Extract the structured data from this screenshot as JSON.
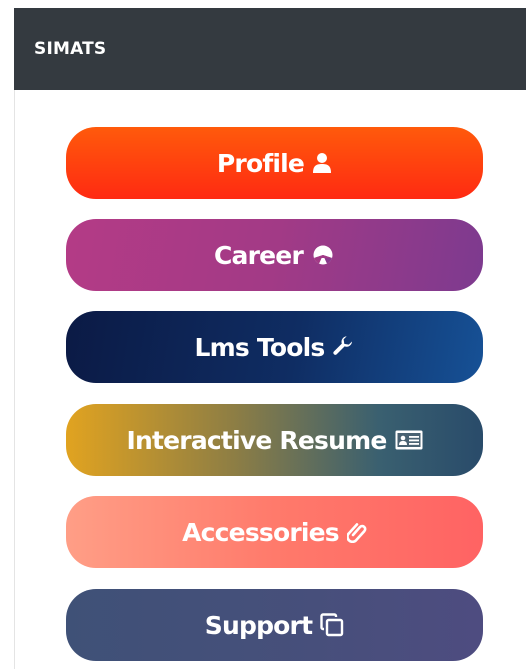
{
  "header": {
    "brand": "SIMATS",
    "background": "#343a40"
  },
  "menu": [
    {
      "id": "profile",
      "label": "Profile",
      "icon": "user-icon",
      "colors": [
        "#ff5a0b",
        "#ff2a12"
      ]
    },
    {
      "id": "career",
      "label": "Career",
      "icon": "chart-pie-icon",
      "colors": [
        "#b43b86",
        "#7d3a8f"
      ]
    },
    {
      "id": "lms",
      "label": "Lms Tools",
      "icon": "wrench-icon",
      "colors": [
        "#0b1a45",
        "#165196"
      ]
    },
    {
      "id": "resume",
      "label": "Interactive Resume",
      "icon": "id-card-icon",
      "colors": [
        "#e1a320",
        "#294b6a"
      ]
    },
    {
      "id": "accessories",
      "label": "Accessories",
      "icon": "paperclip-icon",
      "colors": [
        "#ff9e86",
        "#ff6363"
      ]
    },
    {
      "id": "support",
      "label": "Support",
      "icon": "clone-icon",
      "colors": [
        "#3f5177",
        "#4e4c80"
      ]
    }
  ]
}
